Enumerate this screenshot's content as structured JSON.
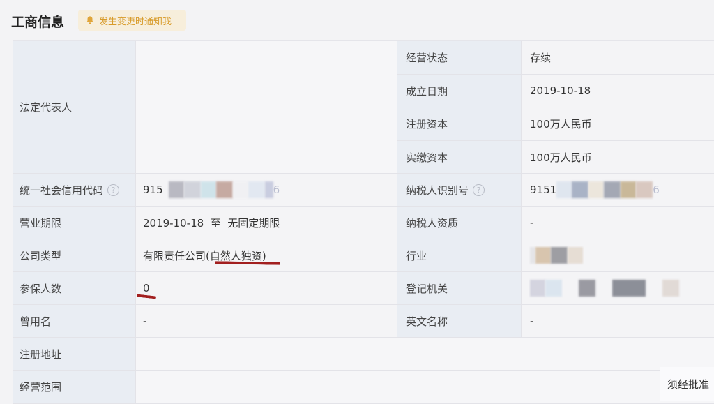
{
  "header": {
    "title": "工商信息",
    "notify_label": "发生变更时通知我",
    "bell_color": "#d89b2a"
  },
  "rows": {
    "legal_rep_label": "法定代表人",
    "legal_rep_value": "",
    "status_label": "经营状态",
    "status_value": "存续",
    "est_date_label": "成立日期",
    "est_date_value": "2019-10-18",
    "reg_capital_label": "注册资本",
    "reg_capital_value": "100万人民币",
    "paid_capital_label": "实缴资本",
    "paid_capital_value": "100万人民币",
    "credit_code_label": "统一社会信用代码",
    "credit_code_prefix": "915",
    "credit_code_suffix": "6",
    "taxpayer_id_label": "纳税人识别号",
    "taxpayer_id_prefix": "9151",
    "taxpayer_id_suffix": "6",
    "term_label": "营业期限",
    "term_value": "2019-10-18  至  无固定期限",
    "taxpayer_qual_label": "纳税人资质",
    "taxpayer_qual_value": "-",
    "company_type_label": "公司类型",
    "company_type_value": "有限责任公司(自然人独资)",
    "industry_label": "行业",
    "insured_label": "参保人数",
    "insured_value": "0",
    "reg_authority_label": "登记机关",
    "former_name_label": "曾用名",
    "former_name_value": "-",
    "english_name_label": "英文名称",
    "english_name_value": "-",
    "reg_address_label": "注册地址",
    "scope_label": "经营范围",
    "scope_tail": "须经批准"
  },
  "colors": {
    "label_bg": "#e9edf3",
    "value_bg": "#f4f4f6",
    "annotation_red": "#a21f1f"
  }
}
